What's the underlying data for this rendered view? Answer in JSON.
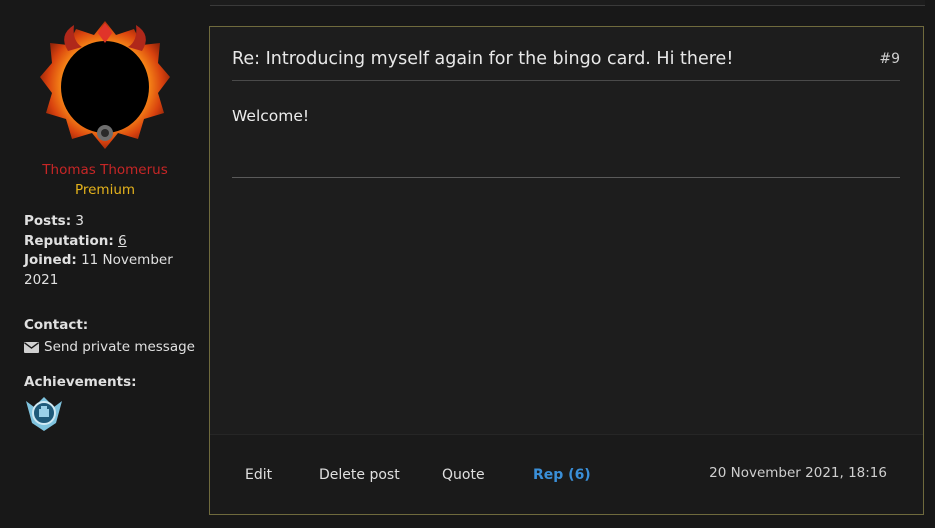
{
  "user": {
    "name": "Thomas Thomerus",
    "group": "Premium",
    "posts_label": "Posts:",
    "posts_value": "3",
    "reputation_label": "Reputation:",
    "reputation_value": "6",
    "joined_label": "Joined:",
    "joined_value": "11 November 2021",
    "contact_label": "Contact:",
    "pm_label": "Send private message",
    "achievements_label": "Achievements:"
  },
  "post": {
    "title": "Re: Introducing myself again for the bingo card. Hi there!",
    "number": "#9",
    "body": "Welcome!",
    "date": "20 November 2021, 18:16",
    "actions": {
      "edit": "Edit",
      "delete": "Delete post",
      "quote": "Quote",
      "rep": "Rep (6)"
    }
  },
  "colors": {
    "username": "#c62626",
    "group": "#e4b21c",
    "rep_button": "#3a8fd8",
    "post_border": "#6f6a3d"
  }
}
